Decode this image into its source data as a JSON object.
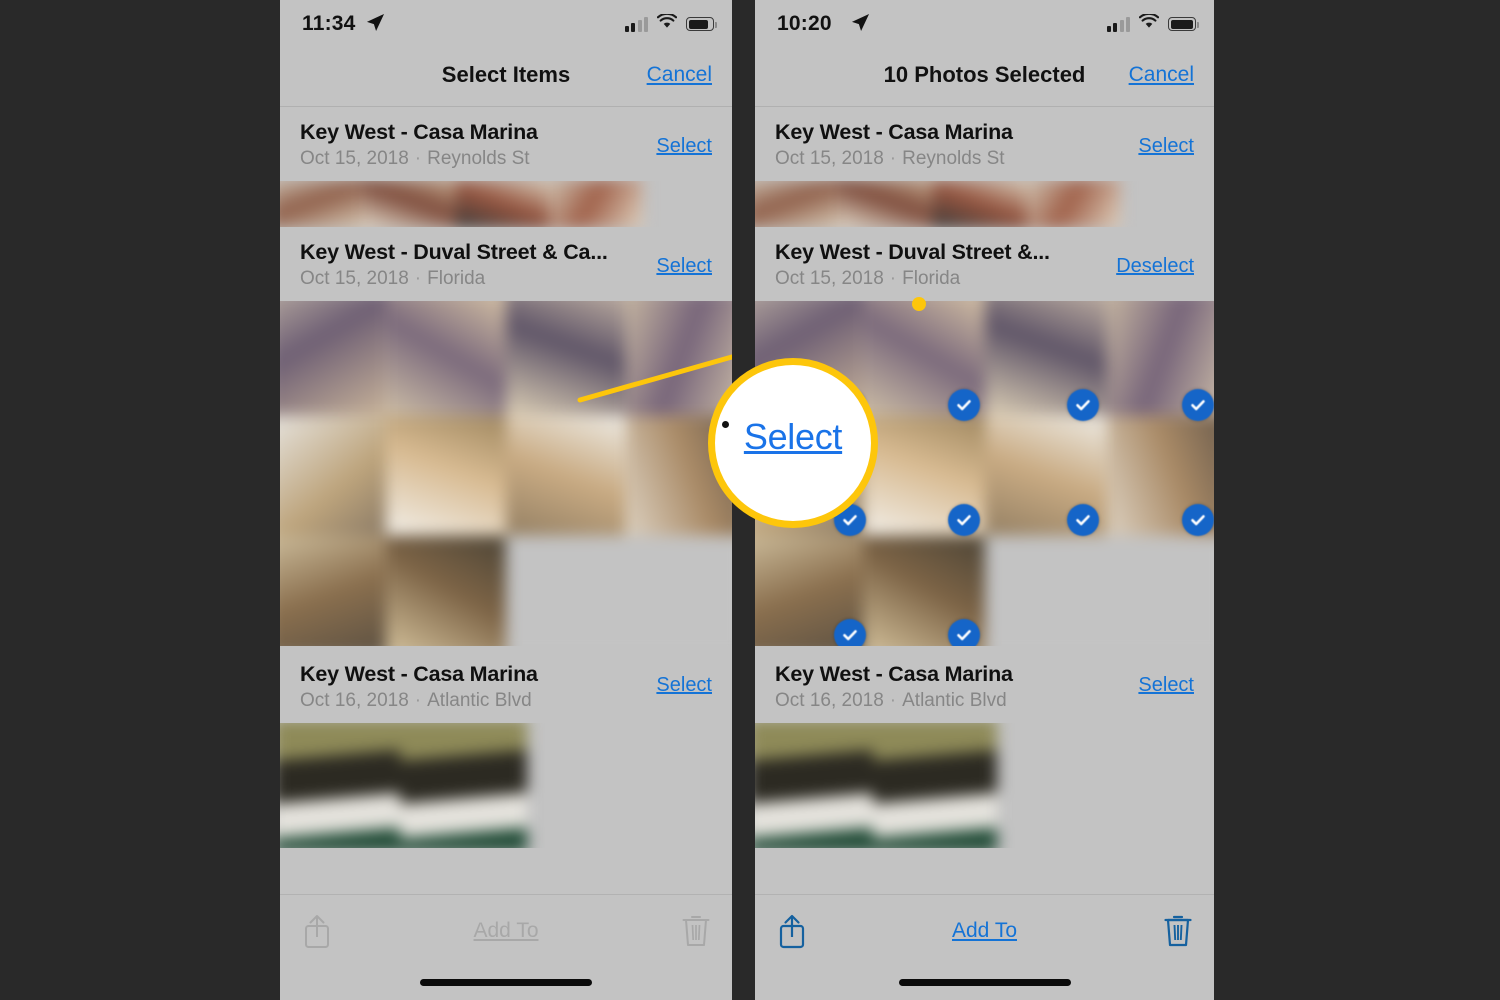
{
  "background_color": "#292929",
  "accent_blue": "#1473d6",
  "callout_yellow": "#fdc60b",
  "check_blue": "#1565c8",
  "panels": [
    {
      "id": "left",
      "status_bar": {
        "time": "11:34",
        "location_icon": "location-arrow-icon",
        "signal_icon": "cellular-signal-icon",
        "wifi_icon": "wifi-icon",
        "battery_icon": "battery-icon"
      },
      "nav": {
        "title": "Select Items",
        "cancel_label": "Cancel"
      },
      "sections": [
        {
          "title": "Key West - Casa Marina",
          "date": "Oct 15, 2018",
          "separator": "·",
          "place": "Reynolds St",
          "action_label": "Select",
          "action_state": "unselected"
        },
        {
          "title": "Key West - Duval Street & Ca...",
          "date": "Oct 15, 2018",
          "separator": "·",
          "place": "Florida",
          "action_label": "Select",
          "action_state": "unselected"
        },
        {
          "title": "Key West - Casa Marina",
          "date": "Oct 16, 2018",
          "separator": "·",
          "place": "Atlantic Blvd",
          "action_label": "Select",
          "action_state": "unselected"
        }
      ],
      "toolbar": {
        "share_icon": "share-icon",
        "add_to_label": "Add To",
        "trash_icon": "trash-icon",
        "enabled": false
      },
      "selected_checkmarks": 0
    },
    {
      "id": "right",
      "status_bar": {
        "time": "10:20",
        "location_icon": "location-arrow-icon",
        "signal_icon": "cellular-signal-icon",
        "wifi_icon": "wifi-icon",
        "battery_icon": "battery-icon"
      },
      "nav": {
        "title": "10 Photos Selected",
        "cancel_label": "Cancel"
      },
      "sections": [
        {
          "title": "Key West - Casa Marina",
          "date": "Oct 15, 2018",
          "separator": "·",
          "place": "Reynolds St",
          "action_label": "Select",
          "action_state": "unselected"
        },
        {
          "title": "Key West - Duval Street &...",
          "date": "Oct 15, 2018",
          "separator": "·",
          "place": "Florida",
          "action_label": "Deselect",
          "action_state": "selected"
        },
        {
          "title": "Key West - Casa Marina",
          "date": "Oct 16, 2018",
          "separator": "·",
          "place": "Atlantic Blvd",
          "action_label": "Select",
          "action_state": "unselected"
        }
      ],
      "toolbar": {
        "share_icon": "share-icon",
        "add_to_label": "Add To",
        "trash_icon": "trash-icon",
        "enabled": true
      },
      "selected_checkmarks": 10
    }
  ],
  "callout": {
    "magnified_label": "Select",
    "shape": "circle",
    "pointer": "line-to-select-link"
  }
}
